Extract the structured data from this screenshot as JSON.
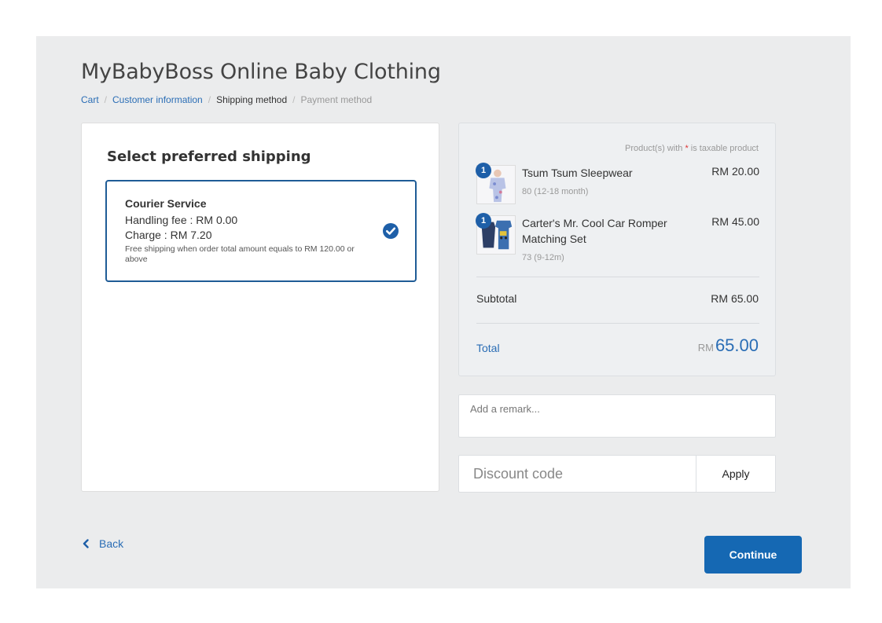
{
  "store": {
    "title": "MyBabyBoss Online Baby Clothing"
  },
  "breadcrumb": {
    "items": [
      {
        "label": "Cart"
      },
      {
        "label": "Customer information"
      },
      {
        "label": "Shipping method"
      },
      {
        "label": "Payment method"
      }
    ],
    "separator": "/"
  },
  "shipping": {
    "heading": "Select preferred shipping",
    "option": {
      "name": "Courier Service",
      "handling_fee": "Handling fee : RM 0.00",
      "charge": "Charge : RM 7.20",
      "note": "Free shipping when order total amount equals to RM 120.00 or above",
      "selected_icon": "check-circle-icon"
    }
  },
  "summary": {
    "tax_note_prefix": "Product(s) with ",
    "tax_note_star": "*",
    "tax_note_suffix": " is taxable product",
    "products": [
      {
        "qty": "1",
        "name": "Tsum Tsum Sleepwear",
        "variant": "80 (12-18 month)",
        "price": "RM 20.00"
      },
      {
        "qty": "1",
        "name": "Carter's Mr. Cool Car Romper Matching Set",
        "variant": "73 (9-12m)",
        "price": "RM 45.00"
      }
    ],
    "subtotal_label": "Subtotal",
    "subtotal_value": "RM 65.00",
    "total_label": "Total",
    "total_currency": "RM",
    "total_amount": "65.00"
  },
  "remark": {
    "placeholder": "Add a remark..."
  },
  "discount": {
    "placeholder": "Discount code",
    "apply_label": "Apply"
  },
  "nav": {
    "back_label": "Back",
    "back_icon": "chevron-left-icon",
    "continue_label": "Continue"
  },
  "colors": {
    "accent": "#1568b3",
    "link": "#2a6db5",
    "page_bg": "#ebeced"
  }
}
